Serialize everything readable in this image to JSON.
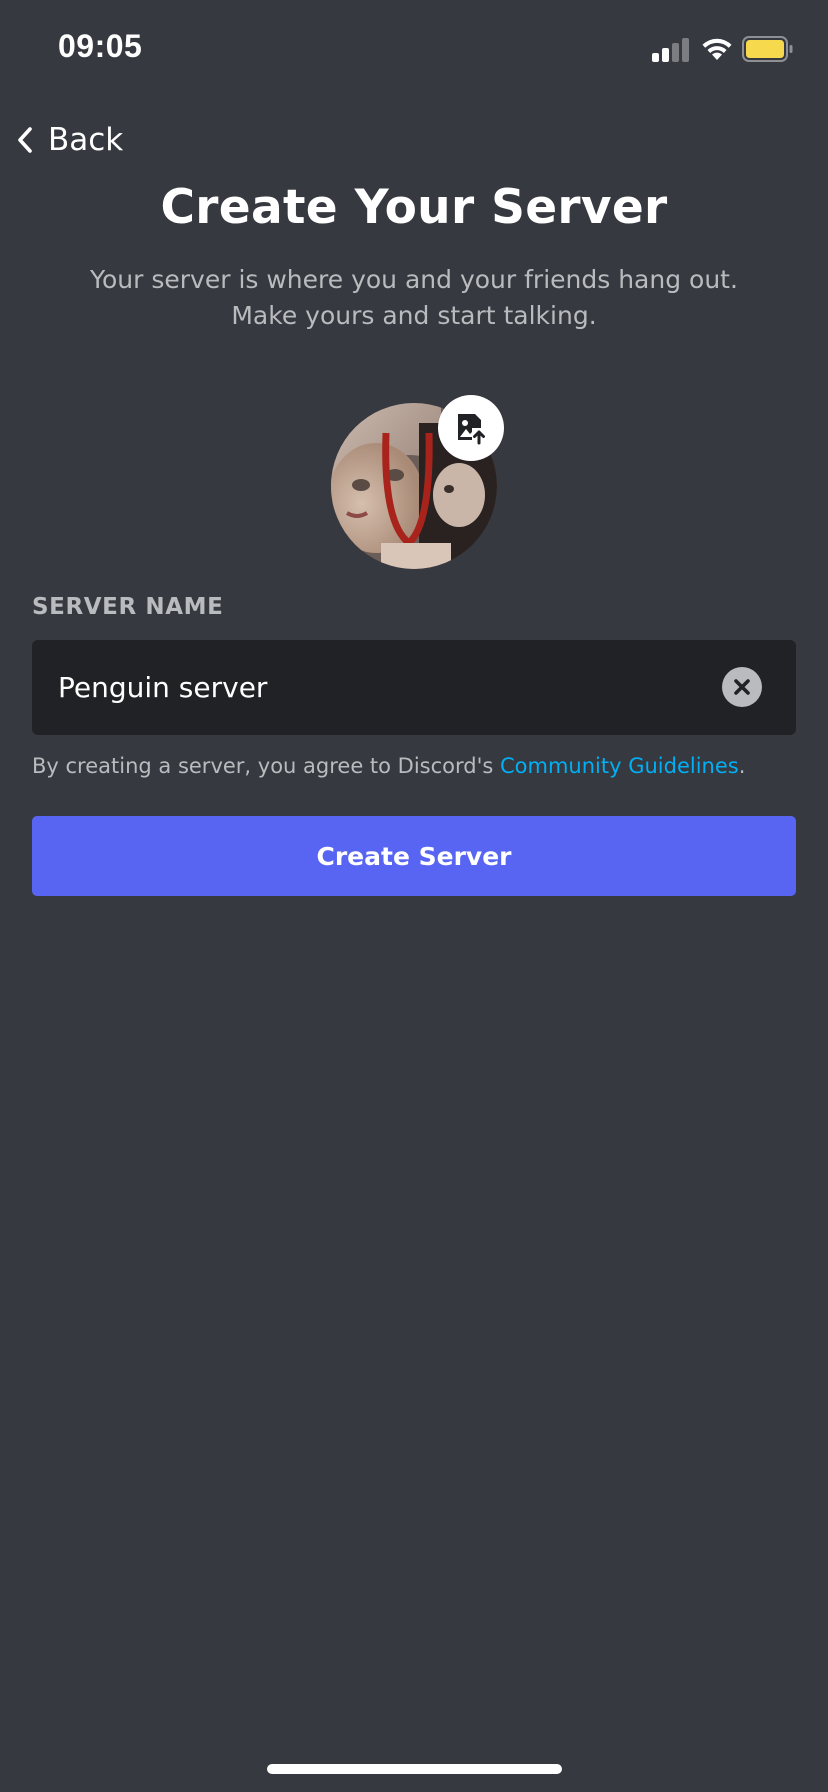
{
  "status_bar": {
    "time": "09:05",
    "battery_color": "#f6d94c"
  },
  "nav": {
    "back_label": "Back"
  },
  "header": {
    "title": "Create Your Server",
    "subtitle_line1": "Your server is where you and your friends hang out.",
    "subtitle_line2": "Make yours and start talking."
  },
  "server_icon": {
    "upload_icon": "image-upload-icon"
  },
  "form": {
    "section_label": "SERVER NAME",
    "server_name_value": "Penguin server",
    "clear_icon": "close-icon"
  },
  "agreement": {
    "prefix": "By creating a server, you agree to Discord's ",
    "link": "Community Guidelines",
    "suffix": "."
  },
  "actions": {
    "create_label": "Create Server"
  },
  "colors": {
    "background": "#36393f",
    "input_bg": "#202225",
    "primary": "#5865f2",
    "link": "#00aff4",
    "muted_text": "#b9bbbe"
  }
}
